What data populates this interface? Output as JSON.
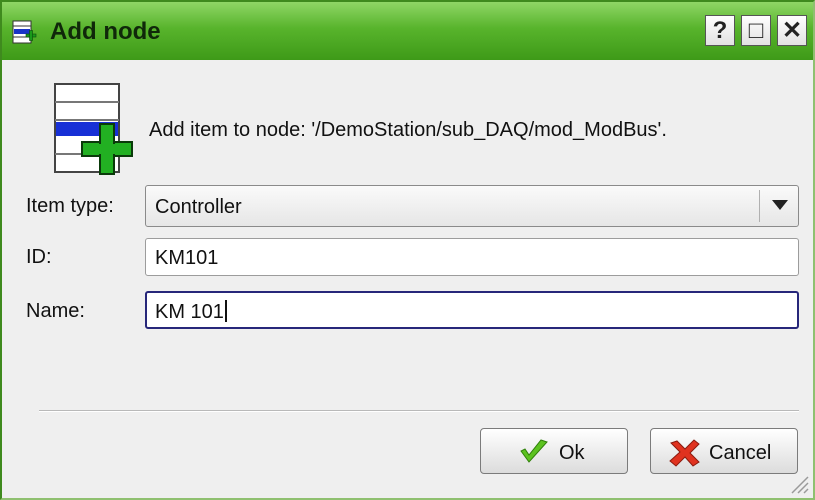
{
  "window": {
    "title": "Add node",
    "icon": "add-node-icon",
    "controls": [
      {
        "name": "help",
        "icon": "question-mark-icon",
        "glyph": "?"
      },
      {
        "name": "maximize",
        "icon": "maximize-icon",
        "glyph": "□"
      },
      {
        "name": "close",
        "icon": "close-icon",
        "glyph": "✕"
      }
    ],
    "accent_color": "#58b42c"
  },
  "message": "Add item to node: '/DemoStation/sub_DAQ/mod_ModBus'.",
  "form": {
    "item_type": {
      "label": "Item type:",
      "value": "Controller"
    },
    "id": {
      "label": "ID:",
      "value": "KM101"
    },
    "name": {
      "label": "Name:",
      "value": "KM 101"
    }
  },
  "buttons": {
    "ok": {
      "label": "Ok",
      "icon": "checkmark-icon"
    },
    "cancel": {
      "label": "Cancel",
      "icon": "red-x-icon"
    }
  }
}
